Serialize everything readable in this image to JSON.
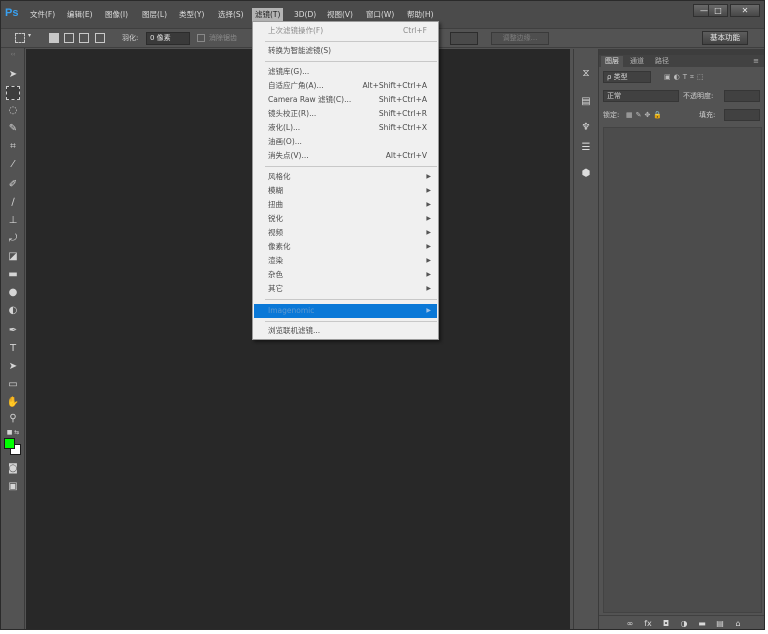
{
  "app": {
    "logo": "Ps"
  },
  "menubar": {
    "items": [
      {
        "label": "文件(F)"
      },
      {
        "label": "编辑(E)"
      },
      {
        "label": "图像(I)"
      },
      {
        "label": "图层(L)"
      },
      {
        "label": "类型(Y)"
      },
      {
        "label": "选择(S)"
      },
      {
        "label": "滤镜(T)"
      },
      {
        "label": "3D(D)"
      },
      {
        "label": "视图(V)"
      },
      {
        "label": "窗口(W)"
      },
      {
        "label": "帮助(H)"
      }
    ],
    "active": "滤镜(T)",
    "window_buttons": {
      "minimize": "—",
      "maximize": "□",
      "close": "✕"
    }
  },
  "options_bar": {
    "feather_label": "羽化:",
    "feather_value": "0 像素",
    "antialias_label": "消除锯齿",
    "refine_edge_button": "调整边缘...",
    "workspace_button": "基本功能"
  },
  "filter_menu": {
    "items": [
      {
        "label": "上次滤镜操作(F)",
        "shortcut": "Ctrl+F",
        "disabled": true
      },
      {
        "separator": true
      },
      {
        "label": "转换为智能滤镜(S)",
        "shortcut": ""
      },
      {
        "separator": true
      },
      {
        "label": "滤镜库(G)...",
        "shortcut": ""
      },
      {
        "label": "自适应广角(A)...",
        "shortcut": "Alt+Shift+Ctrl+A"
      },
      {
        "label": "Camera Raw 滤镜(C)...",
        "shortcut": "Shift+Ctrl+A"
      },
      {
        "label": "镜头校正(R)...",
        "shortcut": "Shift+Ctrl+R"
      },
      {
        "label": "液化(L)...",
        "shortcut": "Shift+Ctrl+X"
      },
      {
        "label": "油画(O)...",
        "shortcut": ""
      },
      {
        "label": "消失点(V)...",
        "shortcut": "Alt+Ctrl+V"
      },
      {
        "separator": true
      },
      {
        "label": "风格化",
        "submenu": true
      },
      {
        "label": "模糊",
        "submenu": true
      },
      {
        "label": "扭曲",
        "submenu": true
      },
      {
        "label": "锐化",
        "submenu": true
      },
      {
        "label": "视频",
        "submenu": true
      },
      {
        "label": "像素化",
        "submenu": true
      },
      {
        "label": "渲染",
        "submenu": true
      },
      {
        "label": "杂色",
        "submenu": true
      },
      {
        "label": "其它",
        "submenu": true
      },
      {
        "separator": true
      },
      {
        "label": "Imagenomic",
        "submenu": true,
        "highlighted": true
      },
      {
        "separator": true
      },
      {
        "label": "浏览联机滤镜...",
        "shortcut": ""
      }
    ],
    "highlight_color": "#0a78d7"
  },
  "layers_panel": {
    "tabs": [
      "图层",
      "通道",
      "路径"
    ],
    "active_tab": "图层",
    "filter_kind": "ρ 类型",
    "blend_mode": "正常",
    "opacity_label": "不透明度:",
    "lock_label": "锁定:",
    "fill_label": "填充:"
  },
  "colors": {
    "foreground": "#00ff00",
    "background": "#ffffff",
    "canvas": "#282828",
    "panel": "#535353",
    "menu_bg": "#f0f0f0"
  }
}
